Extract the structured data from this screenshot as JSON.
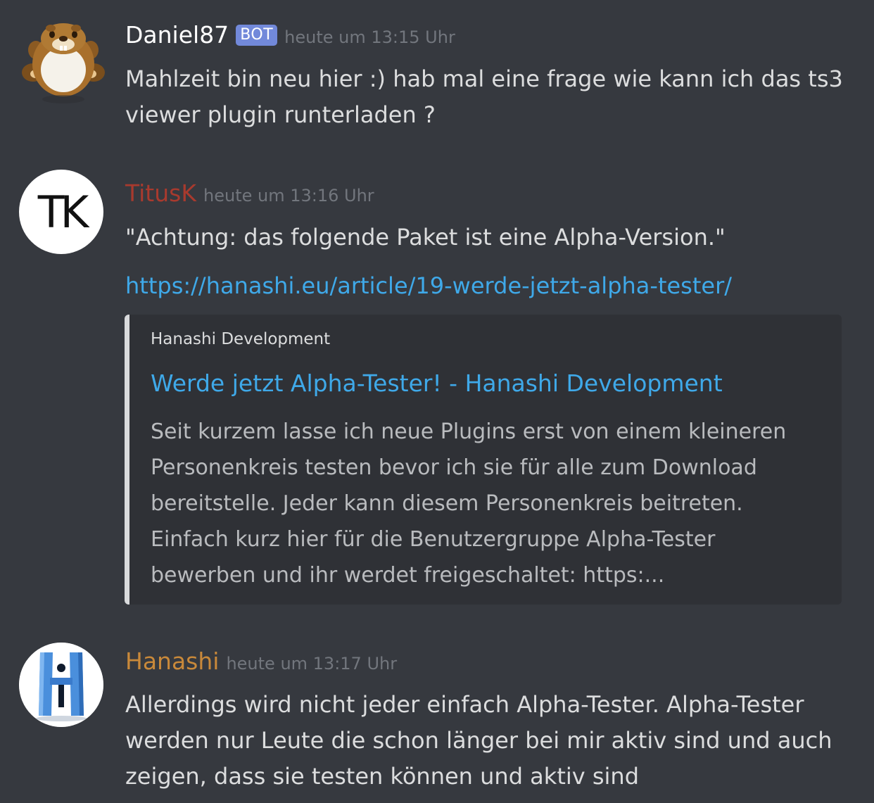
{
  "messages": [
    {
      "username": "Daniel87",
      "username_color": "#ffffff",
      "bot_tag": "BOT",
      "timestamp": "heute um 13:15 Uhr",
      "avatar_icon": "mole-mascot-avatar",
      "text": "Mahlzeit bin neu hier :) hab mal eine frage wie kann ich das ts3 viewer plugin runterladen ?"
    },
    {
      "username": "TitusK",
      "username_color": "#a83a2e",
      "timestamp": "heute um 13:16 Uhr",
      "avatar_text": "TK",
      "text": "\"Achtung: das folgende Paket ist eine Alpha-Version.\"",
      "link": "https://hanashi.eu/article/19-werde-jetzt-alpha-tester/",
      "embed": {
        "provider": "Hanashi Development",
        "title": "Werde jetzt Alpha-Tester! - Hanashi Development",
        "description": "Seit kurzem lasse ich neue Plugins erst von einem kleineren Personenkreis testen bevor ich sie für alle zum Download bereitstelle. Jeder kann diesem Personenkreis beitreten. Einfach kurz hier für die Benutzergruppe Alpha-Tester bewerben und ihr werdet freigeschaltet: https:..."
      }
    },
    {
      "username": "Hanashi",
      "username_color": "#c9893a",
      "timestamp": "heute um 13:17 Uhr",
      "avatar_icon": "hanashi-logo-avatar",
      "text": "Allerdings wird nicht jeder einfach Alpha-Tester. Alpha-Tester werden nur Leute die schon länger bei mir aktiv sind und auch zeigen, dass sie testen können und aktiv sind"
    }
  ],
  "colors": {
    "background": "#36393f",
    "embed_background": "#2f3136",
    "link": "#3fa9e9",
    "bot_tag": "#7289da",
    "timestamp": "#72767d"
  }
}
